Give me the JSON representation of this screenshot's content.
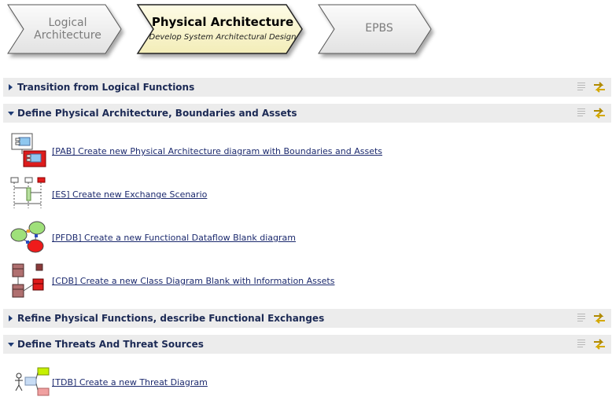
{
  "breadcrumb": {
    "logical": {
      "line1": "Logical",
      "line2": "Architecture"
    },
    "physical": {
      "title": "Physical Architecture",
      "subtitle": "Develop System Architectural Design"
    },
    "epbs": {
      "label": "EPBS"
    }
  },
  "sections": [
    {
      "title": "Transition from Logical Functions",
      "state": "collapsed"
    },
    {
      "title": "Define Physical Architecture, Boundaries and Assets",
      "state": "expanded",
      "items": [
        {
          "label": "[PAB] Create new Physical Architecture diagram with Boundaries and Assets",
          "icon": "physical-architecture-diagram-icon"
        },
        {
          "label": "[ES] Create new Exchange Scenario",
          "icon": "exchange-scenario-icon"
        },
        {
          "label": "[PFDB] Create a new Functional Dataflow Blank diagram",
          "icon": "functional-dataflow-icon"
        },
        {
          "label": "[CDB] Create a new Class Diagram Blank with Information Assets",
          "icon": "class-diagram-icon"
        }
      ]
    },
    {
      "title": "Refine Physical Functions, describe Functional Exchanges",
      "state": "collapsed"
    },
    {
      "title": "Define Threats And Threat Sources",
      "state": "expanded",
      "items": [
        {
          "label": "[TDB] Create a new Threat Diagram",
          "icon": "threat-diagram-icon"
        }
      ]
    }
  ],
  "colors": {
    "section_bg": "#ececec",
    "section_title": "#1c2a55",
    "link": "#1c2a6e",
    "active_crumb": "#fbf7d2"
  },
  "icons": {
    "doc": "document-lines-icon",
    "sync": "sync-arrows-icon"
  }
}
